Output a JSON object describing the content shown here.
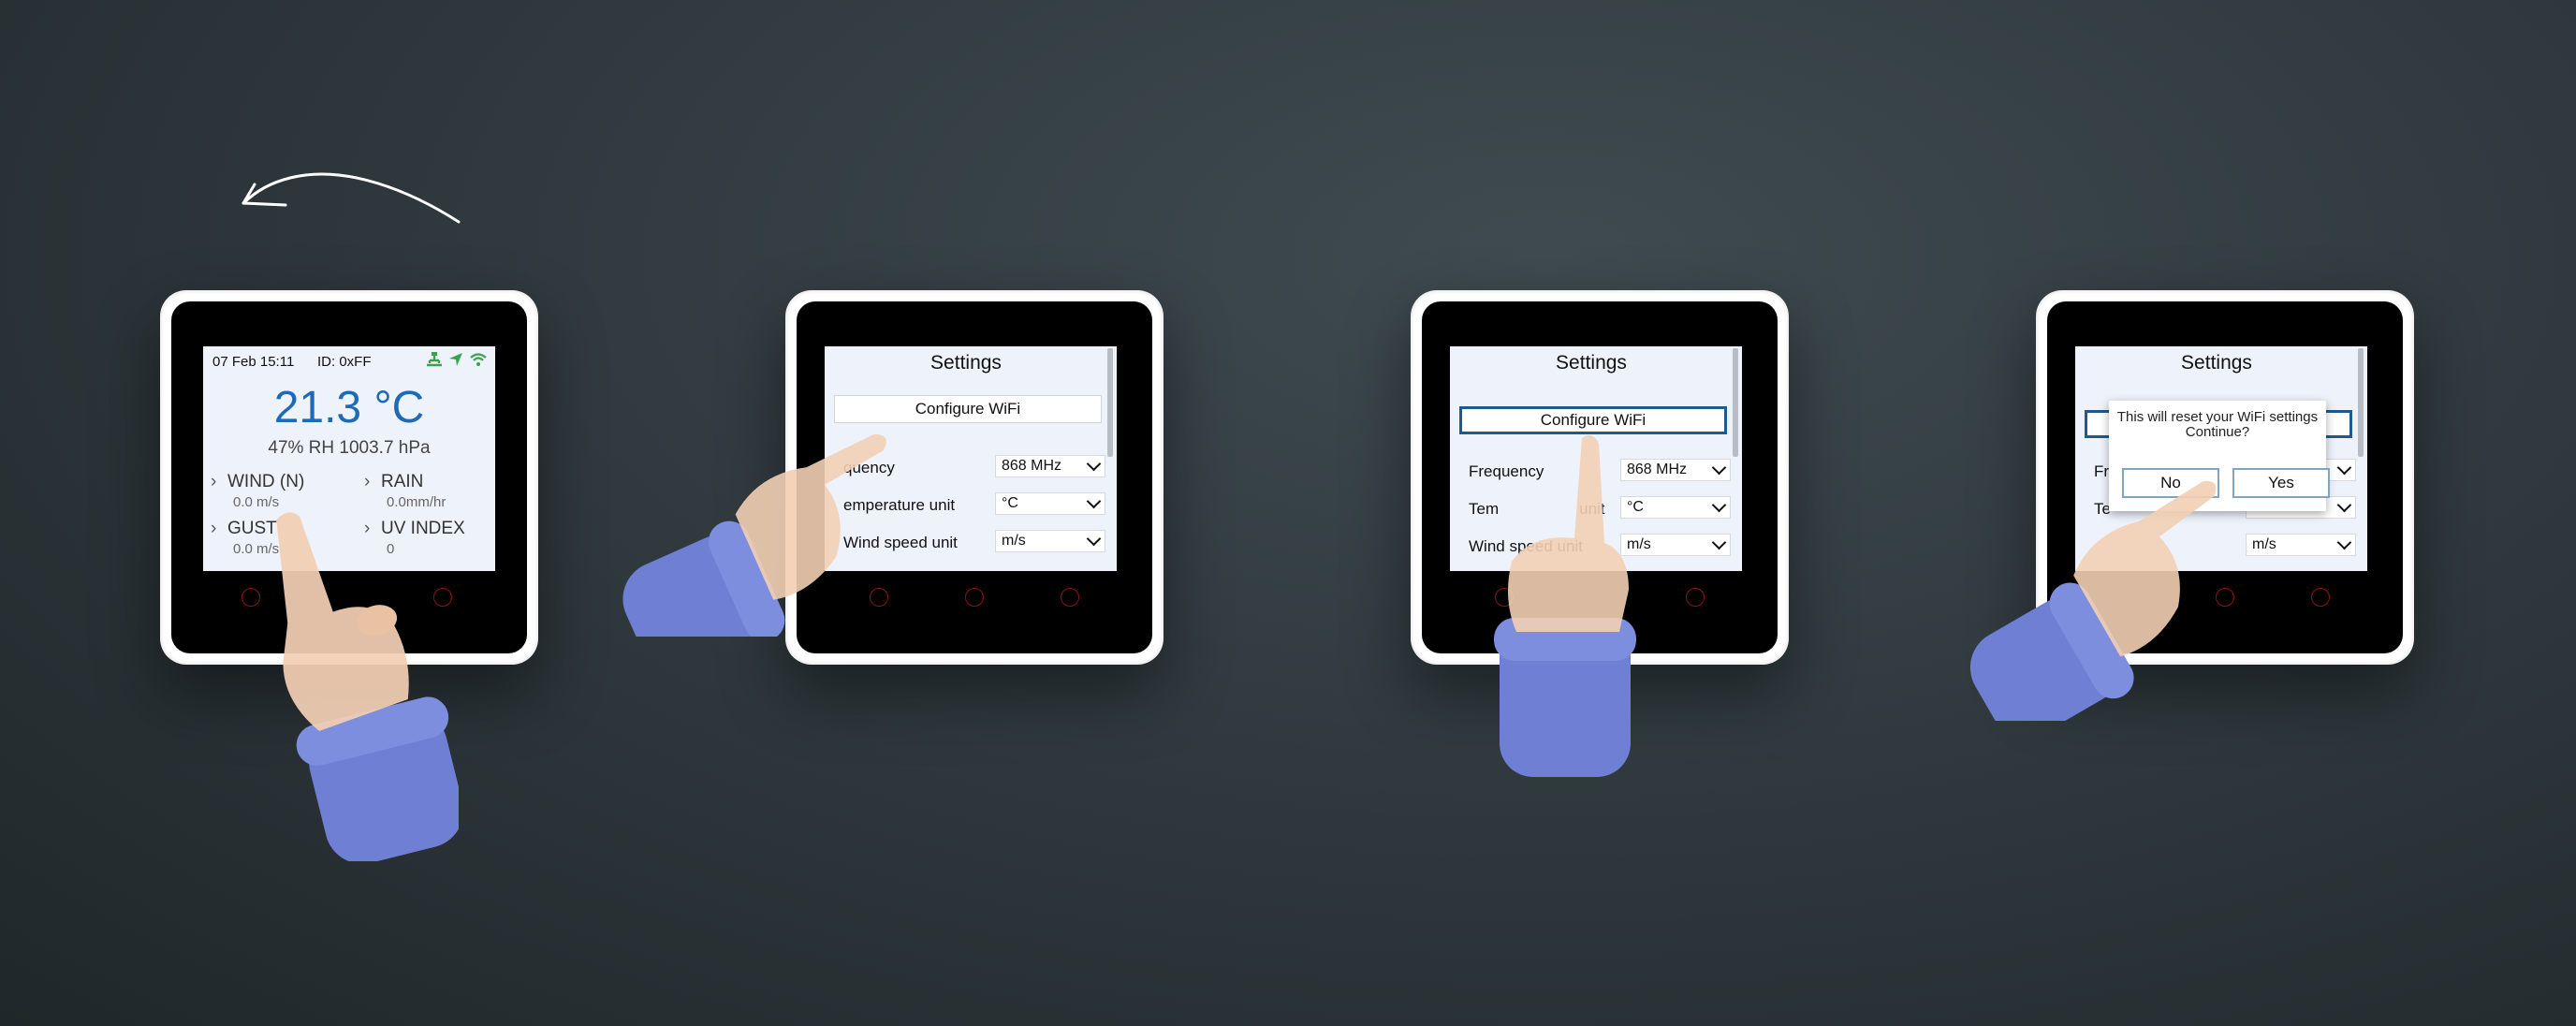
{
  "device1": {
    "datetime": "07 Feb 15:11",
    "device_id": "ID: 0xFF",
    "status_icons": [
      "ethernet-icon",
      "location-arrow-icon",
      "wifi-icon"
    ],
    "temperature": "21.3 °C",
    "humidity_pressure": "47% RH  1003.7 hPa",
    "metrics": [
      {
        "label": "WIND (N)",
        "value": "0.0 m/s"
      },
      {
        "label": "RAIN",
        "value": "0.0mm/hr"
      },
      {
        "label": "GUST",
        "value": "0.0 m/s"
      },
      {
        "label": "UV INDEX",
        "value": "0"
      }
    ]
  },
  "settings": {
    "title": "Settings",
    "configure_wifi": "Configure WiFi",
    "rows": [
      {
        "label": "Frequency",
        "value": "868 MHz"
      },
      {
        "label": "Temperature unit",
        "value": "°C"
      },
      {
        "label": "Wind speed unit",
        "value": "m/s"
      }
    ]
  },
  "device2": {
    "frequency_partial": "quency",
    "temperature_partial": "emperature unit"
  },
  "device3": {
    "temperature_partial": "Tem",
    "temperature_partial_end": "unit",
    "wind_partial": "Wind speed unit"
  },
  "device4": {
    "frequency_partial": "Fr",
    "temperature_partial": "Te",
    "dialog": {
      "message_line1": "This will reset your WiFi settings",
      "message_line2": "Continue?",
      "no_label": "No",
      "yes_label": "Yes"
    }
  },
  "colors": {
    "temperature_blue": "#1e6ab7",
    "status_green": "#3aa34a",
    "selection_blue": "#1e5a8e",
    "sleeve": "#6f80d4",
    "skin": "#f2cfb4"
  }
}
